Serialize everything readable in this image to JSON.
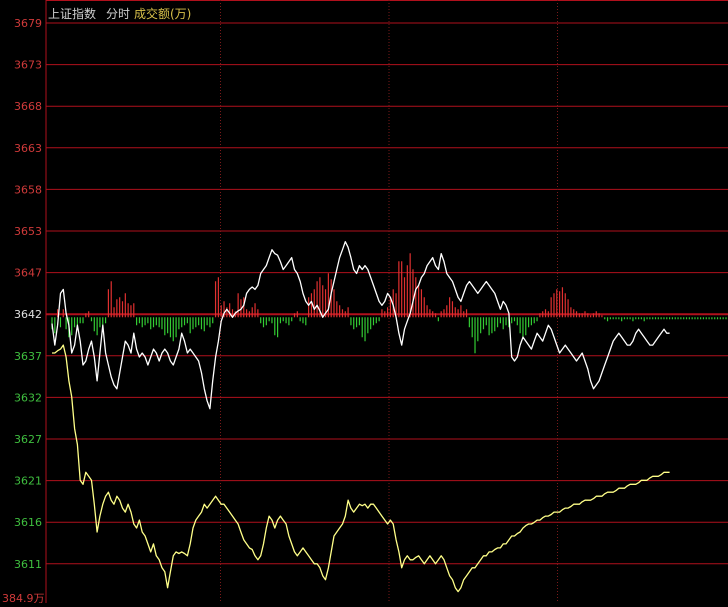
{
  "header": {
    "title": "上证指数",
    "mode": "分时",
    "volume_label": "成交额(万)"
  },
  "colors": {
    "background": "#000000",
    "grid": "#b0101c",
    "vline": "#7a1a1a",
    "axis_text": "#d03a3a",
    "axis_text_green": "#3fbf3f",
    "axis_text_base": "#e0e0e0",
    "price_line": "#ffffff",
    "avg_line": "#ffff88",
    "bar_up": "#e03030",
    "bar_down": "#33cc33"
  },
  "bottom_label": "384.9万",
  "chart_data": {
    "type": "line",
    "base_price": 3642,
    "y_ticks": [
      "3679",
      "3673",
      "3668",
      "3663",
      "3658",
      "3653",
      "3647",
      "3642",
      "3637",
      "3632",
      "3627",
      "3621",
      "3616",
      "3611"
    ],
    "ylim": [
      3606.3,
      3679.4
    ],
    "x_points": 240,
    "sessions": 4,
    "price": [
      3641.2,
      3638.5,
      3641.0,
      3645.0,
      3645.5,
      3642.5,
      3641.0,
      3637.5,
      3638.5,
      3641.0,
      3639.0,
      3636.0,
      3636.5,
      3638.0,
      3639.0,
      3637.0,
      3634.0,
      3637.5,
      3641.0,
      3637.5,
      3636.0,
      3634.5,
      3633.5,
      3633.0,
      3635.0,
      3637.0,
      3639.0,
      3638.5,
      3637.5,
      3640.0,
      3638.0,
      3637.0,
      3637.5,
      3637.0,
      3636.0,
      3637.0,
      3638.0,
      3637.5,
      3636.5,
      3637.5,
      3638.0,
      3637.5,
      3636.5,
      3636.0,
      3637.0,
      3638.0,
      3640.0,
      3639.0,
      3637.5,
      3638.0,
      3637.5,
      3637.0,
      3636.5,
      3635.0,
      3633.0,
      3631.5,
      3630.5,
      3634.0,
      3637.0,
      3639.0,
      3641.5,
      3642.5,
      3643.0,
      3642.5,
      3642.0,
      3642.5,
      3642.8,
      3643.0,
      3643.5,
      3645.0,
      3645.5,
      3645.8,
      3645.5,
      3646.0,
      3647.5,
      3648.0,
      3648.5,
      3649.5,
      3650.5,
      3650.0,
      3649.8,
      3649.0,
      3648.0,
      3648.5,
      3649.0,
      3649.5,
      3648.0,
      3647.5,
      3646.5,
      3645.0,
      3644.0,
      3643.5,
      3644.0,
      3643.0,
      3643.5,
      3642.8,
      3642.0,
      3642.5,
      3643.0,
      3645.0,
      3646.5,
      3648.0,
      3649.5,
      3650.5,
      3651.5,
      3650.8,
      3649.5,
      3648.0,
      3647.5,
      3648.5,
      3648.0,
      3648.5,
      3648.0,
      3647.0,
      3646.0,
      3645.0,
      3644.0,
      3643.5,
      3644.0,
      3645.0,
      3644.5,
      3643.5,
      3642.0,
      3640.0,
      3638.5,
      3640.5,
      3641.5,
      3642.5,
      3644.0,
      3645.5,
      3646.0,
      3647.0,
      3647.5,
      3648.5,
      3649.0,
      3649.5,
      3648.5,
      3648.0,
      3650.0,
      3649.0,
      3647.5,
      3647.0,
      3646.5,
      3645.5,
      3644.5,
      3644.0,
      3645.0,
      3646.0,
      3646.5,
      3646.0,
      3645.5,
      3645.0,
      3645.5,
      3646.0,
      3646.5,
      3646.0,
      3645.5,
      3645.0,
      3644.0,
      3643.0,
      3644.0,
      3643.5,
      3642.5,
      3637.0,
      3636.5,
      3637.0,
      3638.5,
      3639.5,
      3639.0,
      3638.5,
      3638.0,
      3639.0,
      3640.0,
      3639.5,
      3639.0,
      3640.0,
      3641.0,
      3640.5,
      3639.5,
      3638.5,
      3637.5,
      3638.0,
      3638.5,
      3638.0,
      3637.5,
      3637.0,
      3636.5,
      3637.0,
      3637.5,
      3636.5,
      3635.5,
      3634.0,
      3633.0,
      3633.5,
      3634.0,
      3635.0,
      3636.0,
      3637.0,
      3638.0,
      3639.0,
      3639.5,
      3640.0,
      3639.5,
      3639.0,
      3638.5,
      3638.5,
      3639.0,
      3640.0,
      3640.5,
      3640.0,
      3639.5,
      3639.0,
      3638.5,
      3638.5,
      3639.0,
      3639.5,
      3640.0,
      3640.5,
      3640.0,
      3640.0
    ],
    "avg_price": [
      3637.5,
      3637.5,
      3637.8,
      3638.0,
      3638.5,
      3637.0,
      3634.0,
      3632.0,
      3628.0,
      3626.0,
      3621.5,
      3621.0,
      3622.5,
      3622.0,
      3621.5,
      3618.5,
      3615.0,
      3617.0,
      3618.5,
      3619.5,
      3620.0,
      3619.0,
      3618.5,
      3619.5,
      3619.0,
      3618.0,
      3617.5,
      3618.5,
      3617.5,
      3616.0,
      3615.5,
      3616.5,
      3615.0,
      3614.5,
      3613.5,
      3612.5,
      3613.5,
      3612.0,
      3611.5,
      3610.5,
      3610.0,
      3608.0,
      3610.0,
      3612.0,
      3612.5,
      3612.3,
      3612.5,
      3612.3,
      3612.0,
      3613.5,
      3615.5,
      3616.5,
      3617.0,
      3617.5,
      3618.5,
      3618.0,
      3618.5,
      3619.0,
      3619.5,
      3619.0,
      3618.5,
      3618.5,
      3618.0,
      3617.5,
      3617.0,
      3616.5,
      3616.0,
      3615.0,
      3614.0,
      3613.5,
      3613.0,
      3612.8,
      3612.0,
      3611.5,
      3612.0,
      3613.5,
      3615.5,
      3617.0,
      3616.5,
      3615.5,
      3616.5,
      3617.0,
      3616.5,
      3616.0,
      3614.5,
      3613.5,
      3612.5,
      3612.0,
      3612.5,
      3613.0,
      3612.5,
      3612.0,
      3611.5,
      3611.0,
      3611.0,
      3610.5,
      3609.5,
      3609.0,
      3610.5,
      3612.5,
      3614.5,
      3615.0,
      3615.5,
      3616.0,
      3617.0,
      3619.0,
      3618.0,
      3617.5,
      3618.0,
      3618.5,
      3618.3,
      3618.5,
      3618.0,
      3618.5,
      3618.5,
      3618.0,
      3617.5,
      3617.0,
      3616.5,
      3616.0,
      3616.5,
      3616.0,
      3614.0,
      3612.5,
      3610.5,
      3611.5,
      3612.0,
      3611.5,
      3611.5,
      3611.8,
      3612.0,
      3611.5,
      3611.0,
      3611.5,
      3612.0,
      3611.5,
      3611.0,
      3611.5,
      3612.0,
      3611.5,
      3610.5,
      3609.5,
      3609.0,
      3608.0,
      3607.5,
      3608.0,
      3609.0,
      3609.5,
      3610.0,
      3610.5,
      3610.5,
      3611.0,
      3611.5,
      3612.0,
      3612.0,
      3612.5,
      3612.5,
      3612.8,
      3613.0,
      3613.0,
      3613.5,
      3613.5,
      3614.0,
      3614.5,
      3614.5,
      3614.8,
      3615.0,
      3615.5,
      3615.8,
      3616.0,
      3616.0,
      3616.2,
      3616.5,
      3616.5,
      3616.8,
      3617.0,
      3617.0,
      3617.2,
      3617.5,
      3617.5,
      3617.5,
      3617.8,
      3618.0,
      3618.0,
      3618.2,
      3618.5,
      3618.5,
      3618.5,
      3618.8,
      3619.0,
      3619.0,
      3619.0,
      3619.2,
      3619.5,
      3619.5,
      3619.5,
      3619.8,
      3620.0,
      3620.0,
      3620.0,
      3620.2,
      3620.5,
      3620.5,
      3620.5,
      3620.8,
      3621.0,
      3621.0,
      3621.0,
      3621.2,
      3621.5,
      3621.5,
      3621.5,
      3621.8,
      3622.0,
      3622.0,
      3622.0,
      3622.2,
      3622.5,
      3622.5,
      3622.5
    ],
    "volume_bars": [
      -6,
      -8,
      4,
      -5,
      4,
      -6,
      -10,
      -9,
      -5,
      -4,
      -3,
      -3,
      2,
      3,
      -2,
      -7,
      -9,
      -5,
      -4,
      -3,
      14,
      18,
      5,
      9,
      10,
      8,
      12,
      7,
      6,
      7,
      -4,
      -3,
      -5,
      -4,
      -3,
      -6,
      -5,
      -4,
      -5,
      -6,
      -9,
      -8,
      -10,
      -12,
      -10,
      -6,
      -5,
      -4,
      -3,
      -8,
      -6,
      -5,
      -4,
      -6,
      -7,
      -4,
      -5,
      -3,
      18,
      20,
      6,
      8,
      5,
      7,
      4,
      3,
      12,
      9,
      10,
      4,
      3,
      5,
      7,
      4,
      -3,
      -5,
      -4,
      -2,
      -3,
      -9,
      -10,
      -3,
      -2,
      -3,
      -4,
      -2,
      2,
      3,
      -2,
      -3,
      -4,
      10,
      12,
      14,
      18,
      20,
      16,
      14,
      22,
      19,
      14,
      8,
      6,
      4,
      3,
      5,
      -4,
      -6,
      -5,
      -4,
      -10,
      -12,
      -8,
      -6,
      -4,
      -3,
      -2,
      4,
      3,
      5,
      10,
      14,
      12,
      28,
      28,
      20,
      26,
      32,
      24,
      20,
      16,
      14,
      10,
      6,
      4,
      3,
      2,
      -2,
      3,
      4,
      6,
      10,
      8,
      5,
      4,
      6,
      3,
      4,
      -5,
      -10,
      -18,
      -12,
      -8,
      -6,
      -4,
      -9,
      -8,
      -7,
      -5,
      -3,
      -6,
      -4,
      -5,
      -3,
      -2,
      -4,
      -8,
      -10,
      -9,
      -5,
      -4,
      -3,
      -2,
      2,
      3,
      4,
      3,
      10,
      12,
      14,
      13,
      15,
      12,
      9,
      5,
      4,
      3,
      2,
      2,
      3,
      2,
      1,
      2,
      3,
      2,
      1,
      -1,
      -2,
      -1,
      -1,
      -1,
      -1,
      -2,
      -1,
      -1,
      -1,
      -2,
      -1,
      -1,
      -1,
      -2,
      -1,
      -1,
      -1,
      -1,
      -1,
      -1,
      -1,
      -1,
      -1,
      -1,
      -1,
      -1,
      -1,
      -1,
      -1,
      -1,
      -1,
      -1,
      -1,
      -1,
      -1,
      -1,
      -1,
      -1,
      -1,
      -1,
      -1,
      -1,
      -1
    ],
    "volume_unit_label": "384.9万"
  }
}
